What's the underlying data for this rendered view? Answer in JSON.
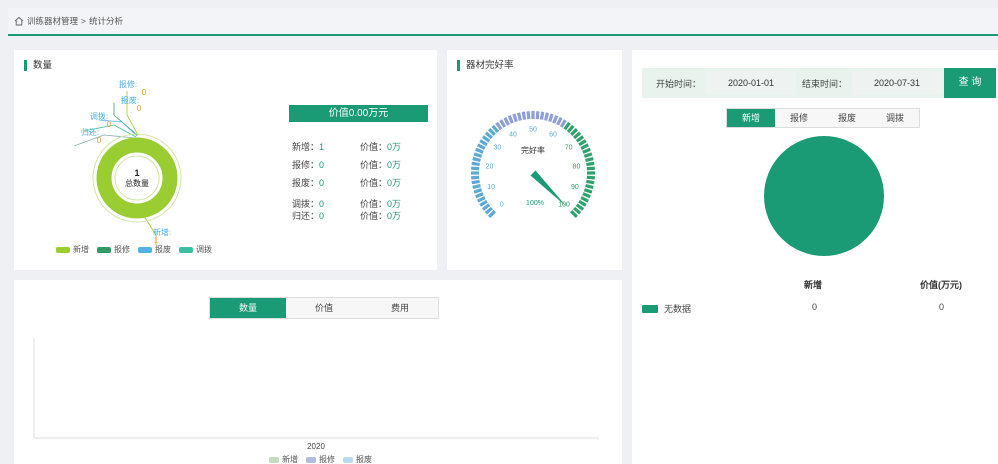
{
  "breadcrumb": {
    "part1": "训练器材管理",
    "sep": ">",
    "part2": "统计分析"
  },
  "qty_panel": {
    "title": "数量",
    "center_value": "1",
    "center_label": "总数量",
    "donut_labels": [
      {
        "name": "报修:",
        "value": "0"
      },
      {
        "name": "报废:",
        "value": "0"
      },
      {
        "name": "调拨:",
        "value": "0"
      },
      {
        "name": "归还:",
        "value": "0"
      },
      {
        "name": "新增:",
        "value": "1"
      }
    ],
    "value_title": "价值0.00万元",
    "stats": [
      {
        "label": "新增：",
        "count": "1",
        "vlabel": "价值：",
        "value": "0万"
      },
      {
        "label": "报修：",
        "count": "0",
        "vlabel": "价值：",
        "value": "0万"
      },
      {
        "label": "报废：",
        "count": "0",
        "vlabel": "价值：",
        "value": "0万"
      },
      {
        "label": "调拨：",
        "count": "0",
        "vlabel": "价值：",
        "value": "0万"
      },
      {
        "label": "归还：",
        "count": "0",
        "vlabel": "价值：",
        "value": "0万"
      }
    ],
    "legend": [
      {
        "label": "新增",
        "color": "#9acd32"
      },
      {
        "label": "报修",
        "color": "#2f9a64"
      },
      {
        "label": "报废",
        "color": "#4fb3e8"
      },
      {
        "label": "调拨",
        "color": "#3cbfa0"
      }
    ]
  },
  "gauge_panel": {
    "title": "器材完好率",
    "label": "完好率",
    "ticks": [
      "0",
      "10",
      "20",
      "30",
      "40",
      "50",
      "60",
      "70",
      "80",
      "90",
      "100"
    ],
    "value_label": "100%",
    "value": 100
  },
  "filter": {
    "start_label": "开始时间：",
    "start_value": "2020-01-01",
    "end_label": "结束时间：",
    "end_value": "2020-07-31",
    "query_label": "查 询"
  },
  "right_tabs": [
    "新增",
    "报修",
    "报废",
    "调拨"
  ],
  "right_table": {
    "col1": "新增",
    "col2": "价值(万元)",
    "row_label": "无数据",
    "row_count": "0",
    "row_value": "0"
  },
  "bottom_tabs": [
    "数量",
    "价值",
    "费用"
  ],
  "bottom_chart": {
    "x_tick": "2020",
    "legend": [
      {
        "label": "新增",
        "color": "#c2dcc0"
      },
      {
        "label": "报修",
        "color": "#b3bde0"
      },
      {
        "label": "报废",
        "color": "#b9dbef"
      }
    ]
  },
  "colors": {
    "accent": "#1a9a75"
  }
}
